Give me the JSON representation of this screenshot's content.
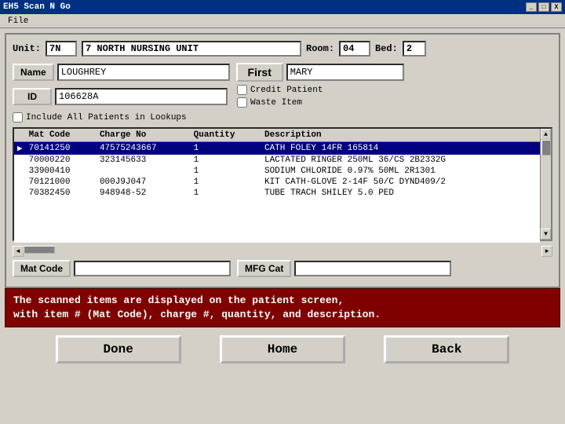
{
  "titleBar": {
    "title": "EH5 Scan N Go",
    "controls": [
      "_",
      "□",
      "X"
    ]
  },
  "menuBar": {
    "items": [
      "File"
    ]
  },
  "unitRow": {
    "unitLabel": "Unit:",
    "unitValue": "7N",
    "unitName": "7 NORTH NURSING UNIT",
    "roomLabel": "Room:",
    "roomValue": "04",
    "bedLabel": "Bed:",
    "bedValue": "2"
  },
  "nameRow": {
    "nameLabel": "Name",
    "nameValue": "LOUGHREY",
    "firstLabel": "First",
    "firstValue": "MARY"
  },
  "idRow": {
    "idLabel": "ID",
    "idValue": "106628A"
  },
  "checkboxes": {
    "creditPatient": "Credit Patient",
    "wasteItem": "Waste Item"
  },
  "includeRow": {
    "label": "Include All Patients in Lookups"
  },
  "table": {
    "columns": [
      {
        "key": "arrow",
        "label": ""
      },
      {
        "key": "matCode",
        "label": "Mat Code"
      },
      {
        "key": "chargeNo",
        "label": "Charge No"
      },
      {
        "key": "quantity",
        "label": "Quantity"
      },
      {
        "key": "description",
        "label": "Description"
      }
    ],
    "rows": [
      {
        "arrow": "▶",
        "matCode": "70141250",
        "chargeNo": "47575243667",
        "quantity": "1",
        "description": "CATH FOLEY 14FR 165814",
        "selected": true
      },
      {
        "arrow": "",
        "matCode": "70000220",
        "chargeNo": "323145633",
        "quantity": "1",
        "description": "LACTATED RINGER 250ML 36/CS 2B2332G",
        "selected": false
      },
      {
        "arrow": "",
        "matCode": "33900410",
        "chargeNo": "",
        "quantity": "1",
        "description": "SODIUM CHLORIDE 0.97% 50ML 2R1301",
        "selected": false
      },
      {
        "arrow": "",
        "matCode": "70121000",
        "chargeNo": "000J9J047",
        "quantity": "1",
        "description": "KIT CATH-GLOVE 2-14F 50/C DYND409/2",
        "selected": false
      },
      {
        "arrow": "",
        "matCode": "70382450",
        "chargeNo": "948948-52",
        "quantity": "1",
        "description": "TUBE TRACH SHILEY 5.0 PED",
        "selected": false
      }
    ]
  },
  "bottomFields": {
    "matCodeLabel": "Mat Code",
    "matCodeValue": "",
    "mfgCatLabel": "MFG Cat",
    "mfgCatValue": ""
  },
  "infoBar": {
    "line1": "The scanned items are displayed on the patient screen,",
    "line2": "with item # (Mat Code), charge #, quantity, and description."
  },
  "buttons": {
    "done": "Done",
    "home": "Home",
    "back": "Back"
  }
}
